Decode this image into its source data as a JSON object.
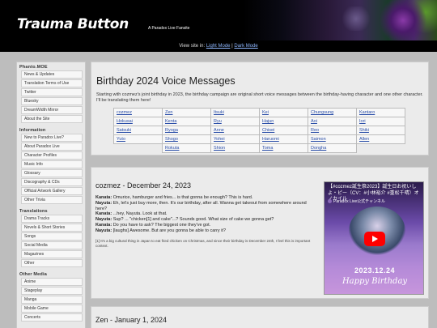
{
  "header": {
    "site_title": "Trauma Button",
    "site_subtitle": "A Paradox Live Fansite",
    "view_prefix": "View site in: ",
    "light_mode": "Light Mode",
    "separator": " | ",
    "dark_mode": "Dark Mode"
  },
  "sidebar": {
    "sections": [
      {
        "heading": "Phanto.MOE",
        "items": [
          "News & Updates",
          "Translation Terms of Use",
          "Twitter",
          "Bluesky",
          "DreamWidth Mirror",
          "About the Site"
        ]
      },
      {
        "heading": "Information",
        "items": [
          "New to Paradox Live?",
          "About Paradox Live",
          "Character Profiles",
          "Music Info",
          "Glossary",
          "Discography & CDs",
          "Official Artwork Gallery",
          "Other Trivia"
        ]
      },
      {
        "heading": "Translations",
        "items": [
          "Drama Tracks",
          "Novels & Short Stories",
          "Songs",
          "Social Media",
          "Magazines",
          "Other"
        ]
      },
      {
        "heading": "Other Media",
        "items": [
          "Anime",
          "Stageplay",
          "Manga",
          "Mobile Game",
          "Concerts"
        ]
      }
    ]
  },
  "main": {
    "title": "Birthday 2024 Voice Messages",
    "intro": "Starting with cozmez's joint birthday in 2023, the birthday campaign are original short voice messages between the birthday-having character and one other character. I'll be translating them here!",
    "names": [
      [
        "cozmez",
        "Zen",
        "Itsuki",
        "Kei",
        "Chungsung",
        "Kantaro"
      ],
      [
        "Hokusai",
        "Kenta",
        "Ryu",
        "Hajun",
        "Aoi",
        "Iori"
      ],
      [
        "Satsuki",
        "Ryoga",
        "Anne",
        "Chisei",
        "Reo",
        "Shiki"
      ],
      [
        "Yuto",
        "Shogo",
        "Yohei",
        "Haruomi",
        "Saimon",
        "Allen"
      ],
      [
        "",
        "Rokuta",
        "Shion",
        "Toma",
        "Dongha",
        ""
      ]
    ]
  },
  "post1": {
    "title": "cozmez - December 24, 2023",
    "lines": [
      {
        "speaker": "Kanata:",
        "text": " Omurice, hamburger and fries... is that gonna be enough? This is hard."
      },
      {
        "speaker": "Nayuta:",
        "text": " Eh, let's just buy more, then. It's our birthday, after all. Wanna get takeout from somewhere around here?"
      },
      {
        "speaker": "Kanata:",
        "text": " ...hey, Nayuta. Look at that."
      },
      {
        "speaker": "Nayuta:",
        "text": " Sup? ... \"chicken[1] and cake\"...? Sounds good. What size of cake we gonna get?"
      },
      {
        "speaker": "Kanata:",
        "text": " Do you have to ask? The biggest one they've got."
      },
      {
        "speaker": "Nayuta:",
        "text": " [laughs] Awesome. But are you gonna be able to carry it?"
      }
    ],
    "note": "[1] It's a big cultural thing in Japan to eat fried chicken on Christmas, and since their birthday is December 24th, I feel this is important context.",
    "video": {
      "title": "【#cozmez誕生祭2023】誕生日お祝いしよ・ピー（CV：#小林裕介 #重松千晴）オノカイル",
      "channel": "Paradox Live公式チャンネル",
      "date": "2023.12.24",
      "caption": "Happy Birthday"
    }
  },
  "post2": {
    "title": "Zen - January 1, 2024"
  },
  "colors": {
    "background": "#bdbdbd",
    "panel": "#ebebeb",
    "link": "#2a4ea8",
    "banner": "#000000"
  }
}
